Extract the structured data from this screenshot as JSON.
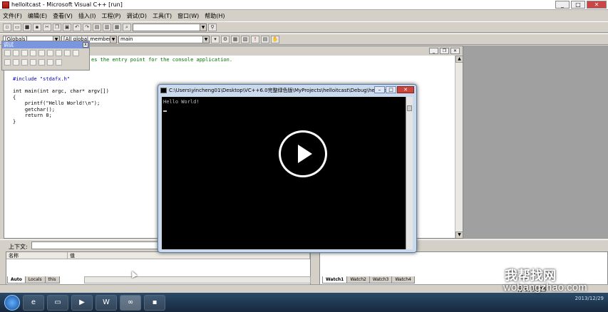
{
  "window": {
    "title": "helloitcast - Microsoft Visual C++ [run]",
    "min": "_",
    "max": "□",
    "close": "✕"
  },
  "menu": [
    "文件(F)",
    "编辑(E)",
    "查看(V)",
    "插入(I)",
    "工程(P)",
    "调试(D)",
    "工具(T)",
    "窗口(W)",
    "帮助(H)"
  ],
  "toolbar2": {
    "scope": "[Globals]",
    "members": "[All global members",
    "function": "main"
  },
  "debug_panel": {
    "title": "调试",
    "close": "x"
  },
  "editor": {
    "comment": "es the entry point for the console application.",
    "code_lines": [
      "",
      "",
      "#include \"stdafx.h\"",
      "",
      "int main(int argc, char* argv[])",
      "{",
      "    printf(\"Hello World!\\n\");",
      "    getchar();",
      "    return 0;",
      "}"
    ]
  },
  "console": {
    "title": "C:\\Users\\yincheng01\\Desktop\\VC++6.0完整绿色版\\MyProjects\\helloitcast\\Debug\\helloita...",
    "output": "Hello World!",
    "min": "–",
    "max": "□",
    "close": "✕"
  },
  "bottom": {
    "context_label": "上下文:",
    "col_name": "名称",
    "col_value": "值"
  },
  "tabs_left": [
    "Auto",
    "Locals",
    "this"
  ],
  "tabs_right": [
    "Watch1",
    "Watch2",
    "Watch3",
    "Watch4"
  ],
  "status": {
    "position": "行 9, 列 15"
  },
  "tray": {
    "date": "2013/12/29"
  },
  "watermark": {
    "line1": "我帮找网",
    "line2": "wobangzhao.com"
  }
}
